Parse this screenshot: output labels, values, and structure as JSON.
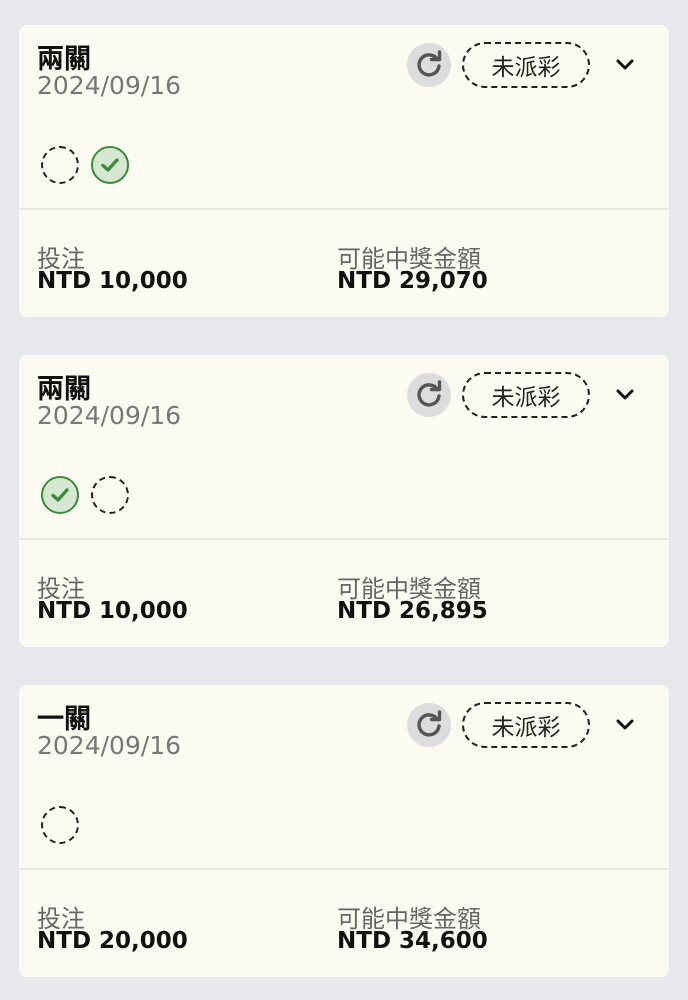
{
  "bets": [
    {
      "title": "兩關",
      "date": "2024/09/16",
      "status": "未派彩",
      "legs": [
        "pending",
        "won"
      ],
      "stake_label": "投注",
      "stake_value": "NTD 10,000",
      "payout_label": "可能中獎金額",
      "payout_value": "NTD 29,070"
    },
    {
      "title": "兩關",
      "date": "2024/09/16",
      "status": "未派彩",
      "legs": [
        "won",
        "pending"
      ],
      "stake_label": "投注",
      "stake_value": "NTD 10,000",
      "payout_label": "可能中獎金額",
      "payout_value": "NTD 26,895"
    },
    {
      "title": "一關",
      "date": "2024/09/16",
      "status": "未派彩",
      "legs": [
        "pending"
      ],
      "stake_label": "投注",
      "stake_value": "NTD 20,000",
      "payout_label": "可能中獎金額",
      "payout_value": "NTD 34,600"
    }
  ],
  "icons": {
    "refresh": "refresh-icon",
    "expand": "chevron-down-icon",
    "leg_won": "check-circle-icon",
    "leg_pending": "dashed-circle-icon"
  },
  "colors": {
    "background": "#e7e8eb",
    "card": "#fcfbf2",
    "won_green": "#3b8c3b",
    "won_fill": "#d7e8d2"
  }
}
